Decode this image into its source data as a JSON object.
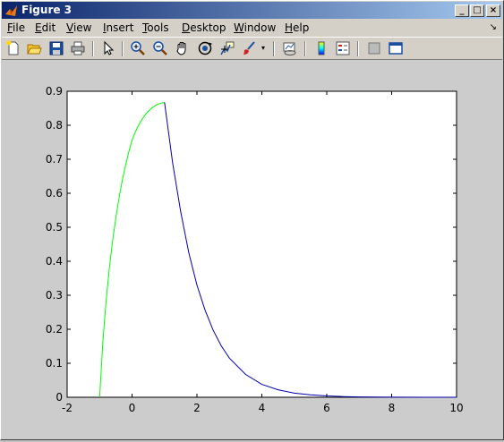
{
  "window": {
    "title": "Figure 3",
    "controls": {
      "minimize": "_",
      "maximize": "□",
      "close": "×"
    }
  },
  "menubar": {
    "items": [
      {
        "label": "File"
      },
      {
        "label": "Edit"
      },
      {
        "label": "View"
      },
      {
        "label": "Insert"
      },
      {
        "label": "Tools"
      },
      {
        "label": "Desktop"
      },
      {
        "label": "Window"
      },
      {
        "label": "Help"
      }
    ],
    "dock_arrow": "↘"
  },
  "toolbar": {
    "icons": [
      "new-figure-icon",
      "open-file-icon",
      "save-icon",
      "print-icon",
      "edit-plot-arrow-icon",
      "zoom-in-icon",
      "zoom-out-icon",
      "pan-hand-icon",
      "rotate-3d-icon",
      "data-cursor-icon",
      "brush-icon",
      "brush-dropdown-icon",
      "link-plot-icon",
      "colorbar-icon",
      "legend-icon",
      "hide-plot-tools-icon",
      "show-plot-tools-icon"
    ]
  },
  "chart_data": {
    "type": "line",
    "title": "",
    "xlabel": "",
    "ylabel": "",
    "xlim": [
      -2,
      10
    ],
    "ylim": [
      0,
      0.9
    ],
    "xticks": [
      "-2",
      "0",
      "2",
      "4",
      "6",
      "8",
      "10"
    ],
    "yticks": [
      "0",
      "0.1",
      "0.2",
      "0.3",
      "0.4",
      "0.5",
      "0.6",
      "0.7",
      "0.8",
      "0.9"
    ],
    "grid": false,
    "series": [
      {
        "color": "#00ff00",
        "x": [
          -1,
          -0.9,
          -0.8,
          -0.7,
          -0.6,
          -0.5,
          -0.4,
          -0.3,
          -0.2,
          -0.1,
          0,
          0.1,
          0.2,
          0.3,
          0.4,
          0.5,
          0.6,
          0.7,
          0.8,
          0.9,
          1
        ],
        "y": [
          0,
          0.164,
          0.283,
          0.379,
          0.46,
          0.528,
          0.587,
          0.638,
          0.683,
          0.722,
          0.756,
          0.78,
          0.8,
          0.816,
          0.83,
          0.841,
          0.85,
          0.857,
          0.862,
          0.865,
          0.867
        ]
      },
      {
        "color": "#0000aa",
        "x": [
          1,
          1.25,
          1.5,
          1.75,
          2,
          2.25,
          2.5,
          2.75,
          3,
          3.5,
          4,
          4.5,
          5,
          5.5,
          6,
          6.5,
          7,
          8,
          9,
          10
        ],
        "y": [
          0.867,
          0.69,
          0.545,
          0.425,
          0.33,
          0.256,
          0.197,
          0.151,
          0.115,
          0.067,
          0.038,
          0.022,
          0.012,
          0.007,
          0.004,
          0.002,
          0.001,
          0.0003,
          0.0001,
          0.0
        ]
      }
    ]
  }
}
